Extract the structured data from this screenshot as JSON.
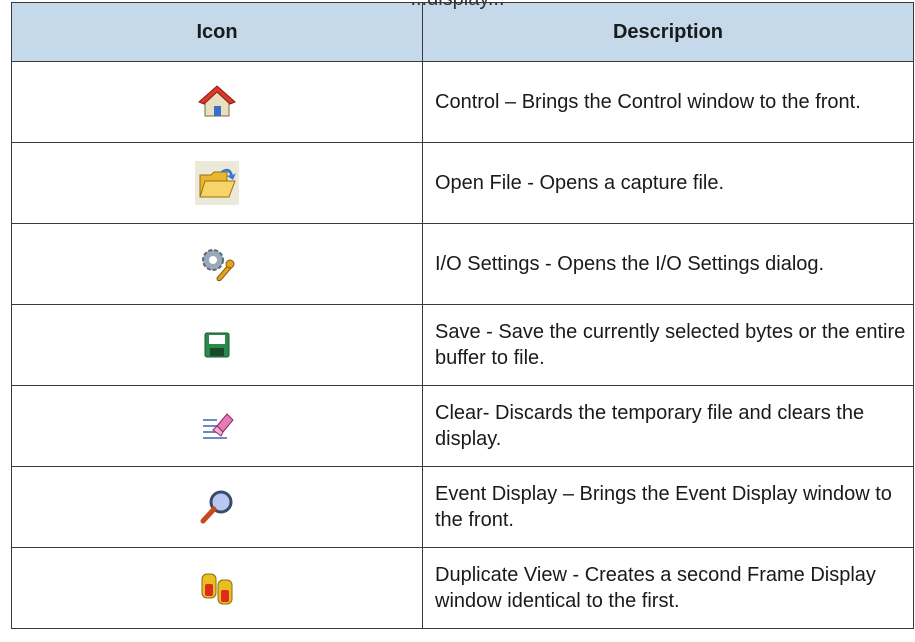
{
  "caption": "...display...",
  "table": {
    "headers": [
      "Icon",
      "Description"
    ],
    "rows": [
      {
        "icon": "home-icon",
        "description": "Control – Brings the Control window to the front."
      },
      {
        "icon": "open-folder-icon",
        "description": "Open File - Opens a capture file."
      },
      {
        "icon": "gear-wrench-icon",
        "description": "I/O Settings - Opens the I/O Settings dialog."
      },
      {
        "icon": "floppy-disk-icon",
        "description": "Save - Save the currently selected bytes or the entire buffer to file."
      },
      {
        "icon": "eraser-icon",
        "description": "Clear- Discards the temporary file and clears the display."
      },
      {
        "icon": "magnifier-icon",
        "description": "Event Display – Brings the Event Display window to the front."
      },
      {
        "icon": "duplicate-view-icon",
        "description": "Duplicate View - Creates a second Frame Display window identical to the first."
      }
    ]
  }
}
